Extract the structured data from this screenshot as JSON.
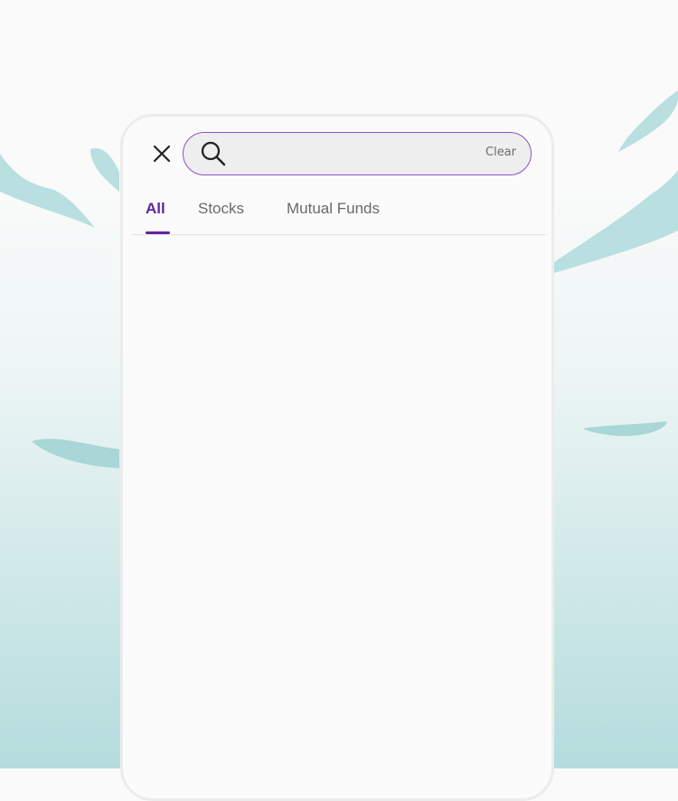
{
  "search": {
    "value": "",
    "clear_label": "Clear"
  },
  "tabs": [
    {
      "label": "All",
      "active": true
    },
    {
      "label": "Stocks",
      "active": false
    },
    {
      "label": "Mutual Funds",
      "active": false
    }
  ],
  "icons": {
    "close": "close-icon",
    "search": "search-icon"
  },
  "colors": {
    "accent": "#5f259f",
    "search_border": "#8e51c6",
    "background_teal": "#b5dcdd"
  }
}
